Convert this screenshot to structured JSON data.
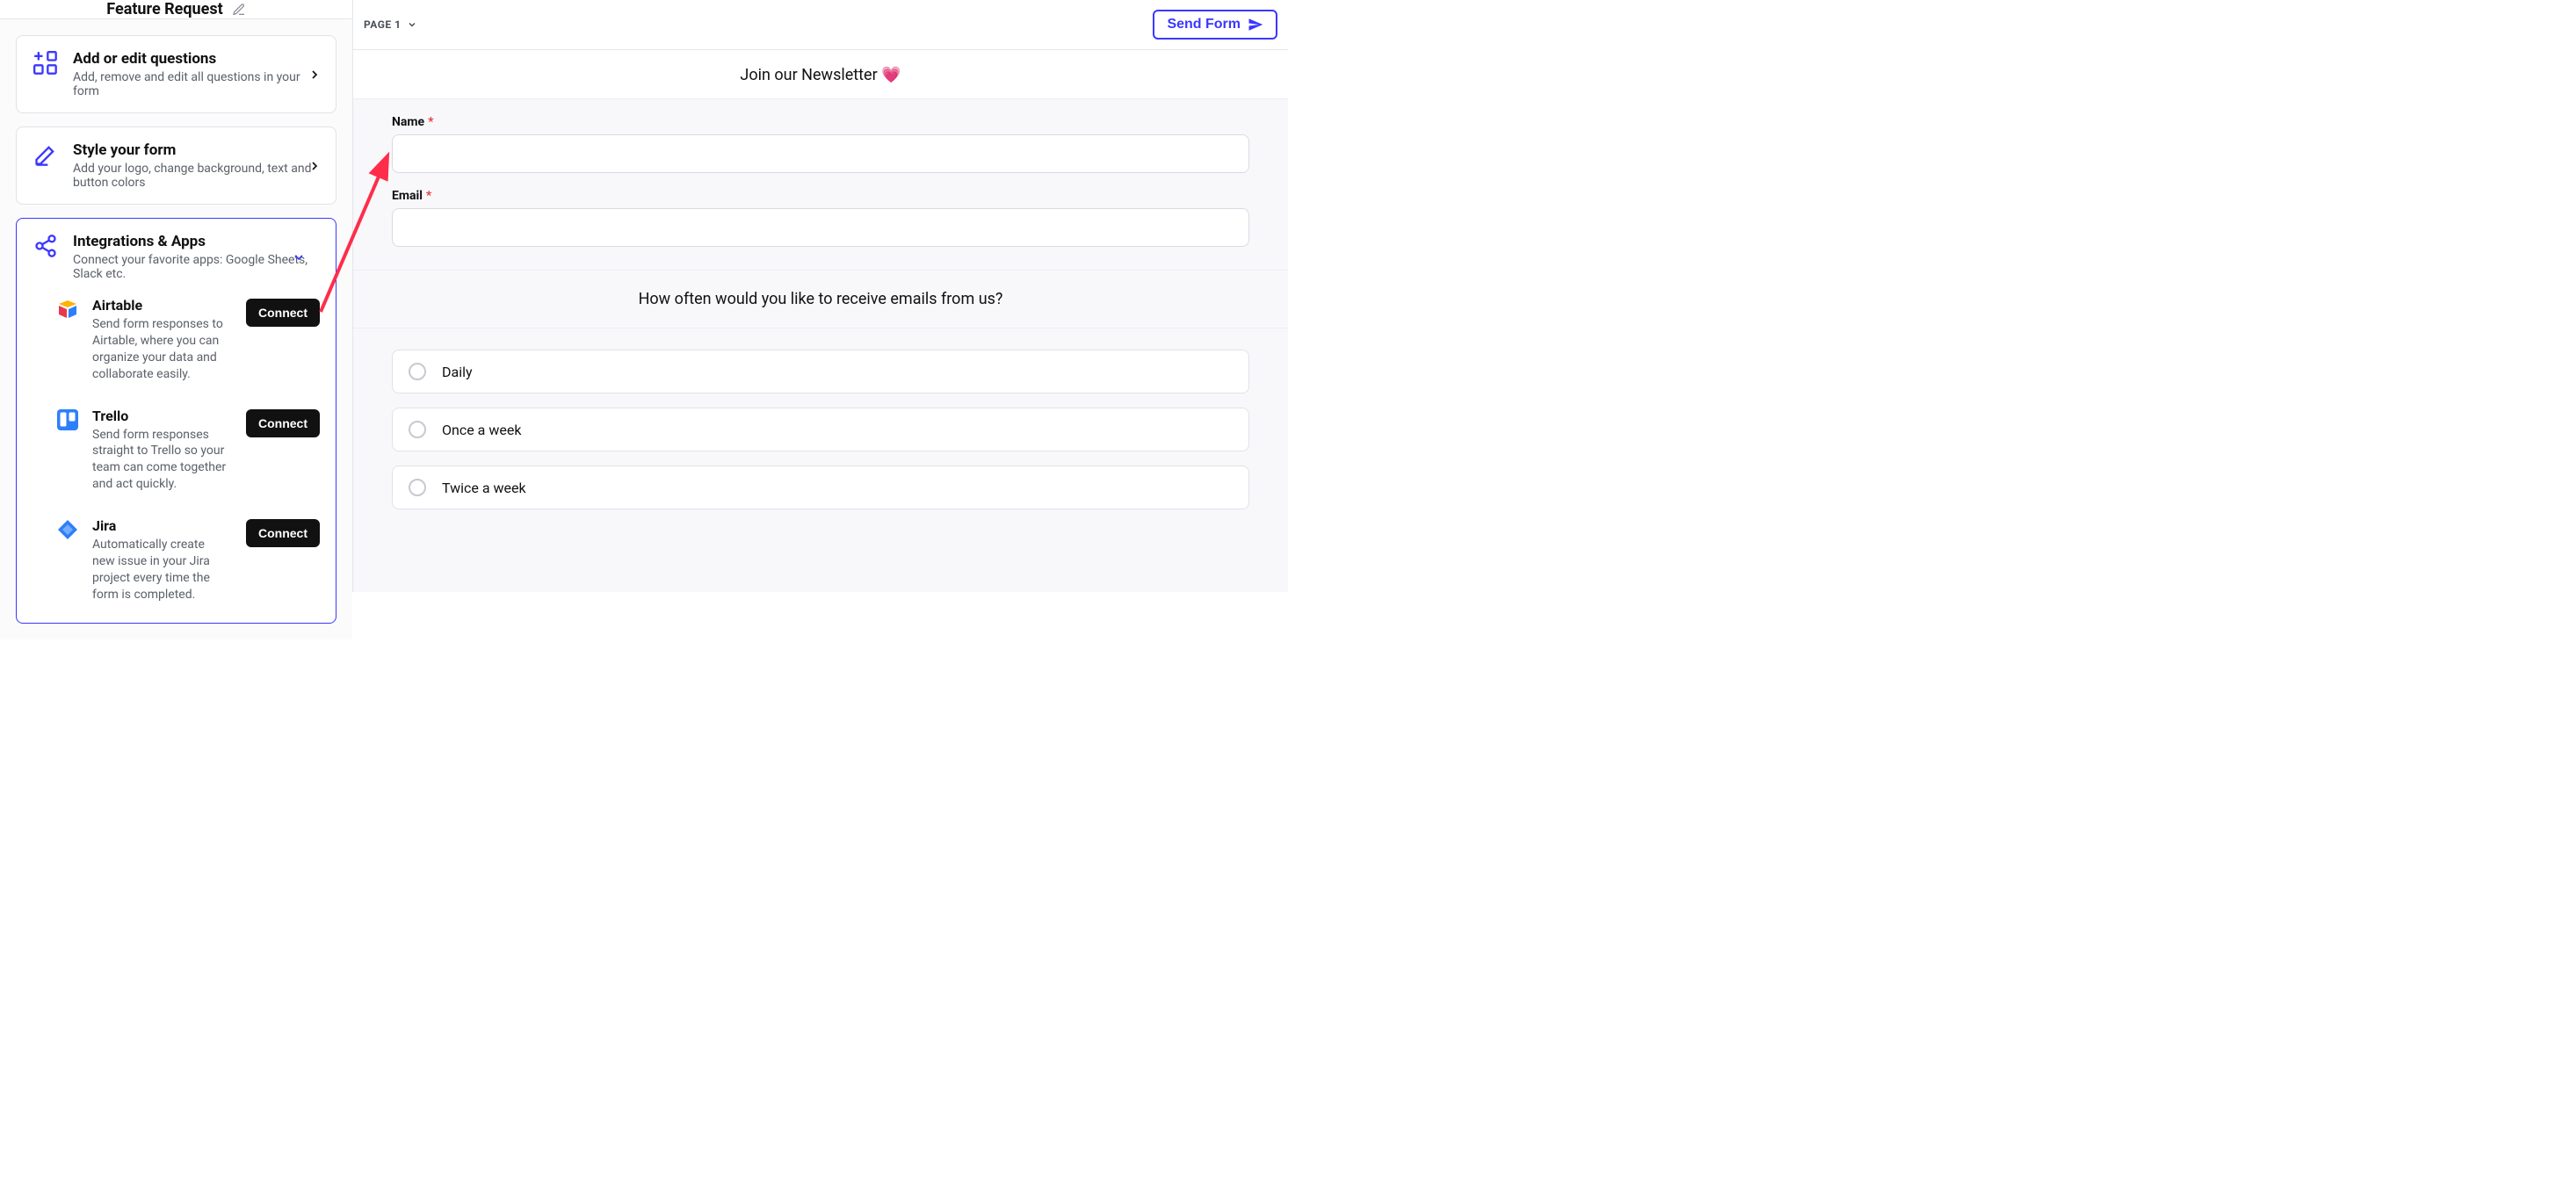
{
  "left": {
    "title": "Feature Request",
    "cards": {
      "questions": {
        "title": "Add or edit questions",
        "sub": "Add, remove and edit all questions in your form"
      },
      "style": {
        "title": "Style your form",
        "sub": "Add your logo, change background, text and button colors"
      },
      "integrations": {
        "title": "Integrations & Apps",
        "sub": "Connect your favorite apps: Google Sheets, Slack etc."
      }
    },
    "integrations": {
      "airtable": {
        "title": "Airtable",
        "sub": "Send form responses to Airtable, where you can organize your data and collaborate easily.",
        "button": "Connect"
      },
      "trello": {
        "title": "Trello",
        "sub": "Send form responses straight to Trello so your team can come together and act quickly.",
        "button": "Connect"
      },
      "jira": {
        "title": "Jira",
        "sub": "Automatically create new issue in your Jira project every time the form is completed.",
        "button": "Connect"
      }
    }
  },
  "right": {
    "page_label": "PAGE 1",
    "send_button": "Send Form",
    "preview_title": "Join our Newsletter 💗",
    "fields": {
      "name": {
        "label": "Name",
        "required": "*"
      },
      "email": {
        "label": "Email",
        "required": "*"
      }
    },
    "question": "How often would you like to receive emails from us?",
    "options": {
      "opt1": "Daily",
      "opt2": "Once a week",
      "opt3": "Twice a week"
    }
  }
}
